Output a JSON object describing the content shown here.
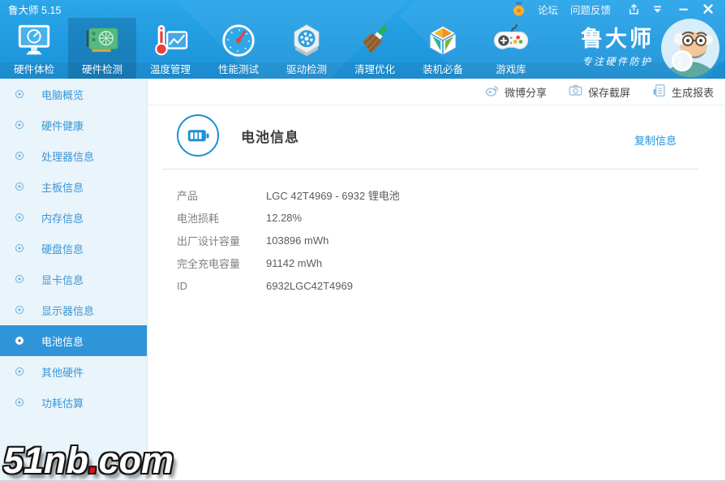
{
  "titlebar": {
    "title": "鲁大师 5.15",
    "forum": "论坛",
    "feedback": "问题反馈"
  },
  "nav": {
    "items": [
      {
        "label": "硬件体检",
        "icon": "monitor-gauge-icon",
        "active": false
      },
      {
        "label": "硬件检测",
        "icon": "gpu-card-icon",
        "active": true
      },
      {
        "label": "温度管理",
        "icon": "thermometer-chart-icon",
        "active": false
      },
      {
        "label": "性能测试",
        "icon": "speedometer-icon",
        "active": false
      },
      {
        "label": "驱动检测",
        "icon": "driver-gear-icon",
        "active": false
      },
      {
        "label": "清理优化",
        "icon": "broom-icon",
        "active": false
      },
      {
        "label": "装机必备",
        "icon": "software-cube-icon",
        "active": false
      },
      {
        "label": "游戏库",
        "icon": "gamepad-icon",
        "active": false
      }
    ]
  },
  "brand": {
    "name": "鲁大师",
    "slogan": "专注硬件防护"
  },
  "actions": {
    "weibo": "微博分享",
    "screenshot": "保存截屏",
    "report": "生成报表"
  },
  "sidebar": {
    "selected_index": 8,
    "items": [
      {
        "label": "电脑概览"
      },
      {
        "label": "硬件健康"
      },
      {
        "label": "处理器信息"
      },
      {
        "label": "主板信息"
      },
      {
        "label": "内存信息"
      },
      {
        "label": "硬盘信息"
      },
      {
        "label": "显卡信息"
      },
      {
        "label": "显示器信息"
      },
      {
        "label": "电池信息"
      },
      {
        "label": "其他硬件"
      },
      {
        "label": "功耗估算"
      }
    ]
  },
  "content": {
    "title": "电池信息",
    "copy_link": "复制信息",
    "rows": [
      {
        "label": "产品",
        "value": "LGC 42T4969 - 6932 锂电池"
      },
      {
        "label": "电池损耗",
        "value": "12.28%"
      },
      {
        "label": "出厂设计容量",
        "value": "103896 mWh"
      },
      {
        "label": "完全充电容量",
        "value": "91142 mWh"
      },
      {
        "label": "ID",
        "value": "6932LGC42T4969"
      }
    ]
  },
  "watermark": {
    "left": "51nb",
    "dot": ".",
    "right": "com"
  },
  "colors": {
    "banner_top": "#2BA6EA",
    "banner_bottom": "#1E93DA",
    "accent": "#1E8FD4",
    "sidebar_bg": "#EAF4FB",
    "sidebar_selected": "#3095D8",
    "sidebar_text": "#3C96D4",
    "link": "#2193DC",
    "label_text": "#7F7F7F",
    "value_text": "#5C5C5C",
    "watermark_dot": "#E01212"
  }
}
